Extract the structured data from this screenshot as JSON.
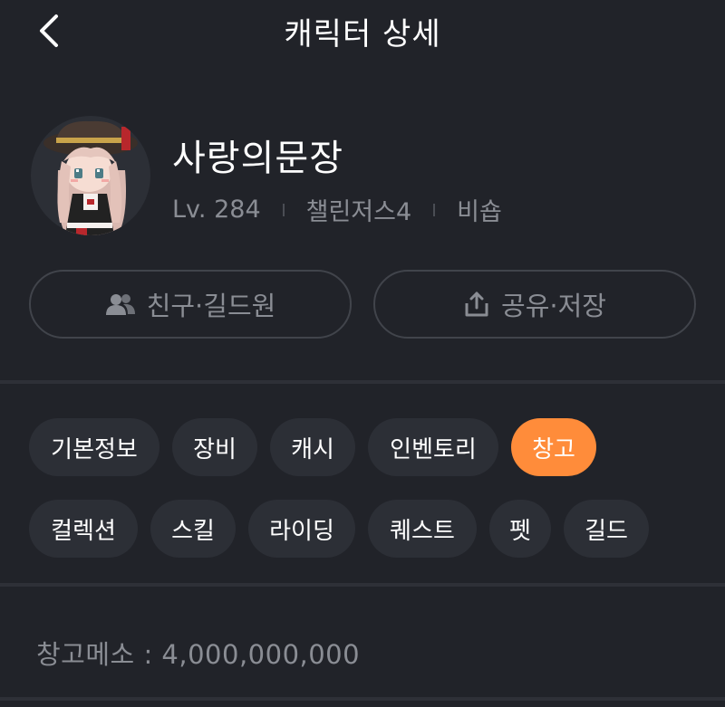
{
  "header": {
    "title": "캐릭터 상세",
    "back_icon": "chevron-left-icon"
  },
  "character": {
    "name": "사랑의문장",
    "level": "Lv. 284",
    "world": "챌린저스4",
    "job": "비숍"
  },
  "actions": {
    "friends_label": "친구·길드원",
    "friends_icon": "people-icon",
    "share_label": "공유·저장",
    "share_icon": "share-icon"
  },
  "tabs": [
    {
      "label": "기본정보",
      "active": false
    },
    {
      "label": "장비",
      "active": false
    },
    {
      "label": "캐시",
      "active": false
    },
    {
      "label": "인벤토리",
      "active": false
    },
    {
      "label": "창고",
      "active": true
    },
    {
      "label": "컬렉션",
      "active": false
    },
    {
      "label": "스킬",
      "active": false
    },
    {
      "label": "라이딩",
      "active": false
    },
    {
      "label": "퀘스트",
      "active": false
    },
    {
      "label": "펫",
      "active": false
    },
    {
      "label": "길드",
      "active": false
    }
  ],
  "storage": {
    "mesos_text": "창고메소 : 4,000,000,000"
  },
  "colors": {
    "background": "#212329",
    "accent": "#ff8c3a",
    "chip": "#2c2f36",
    "muted": "#8a8d94"
  }
}
